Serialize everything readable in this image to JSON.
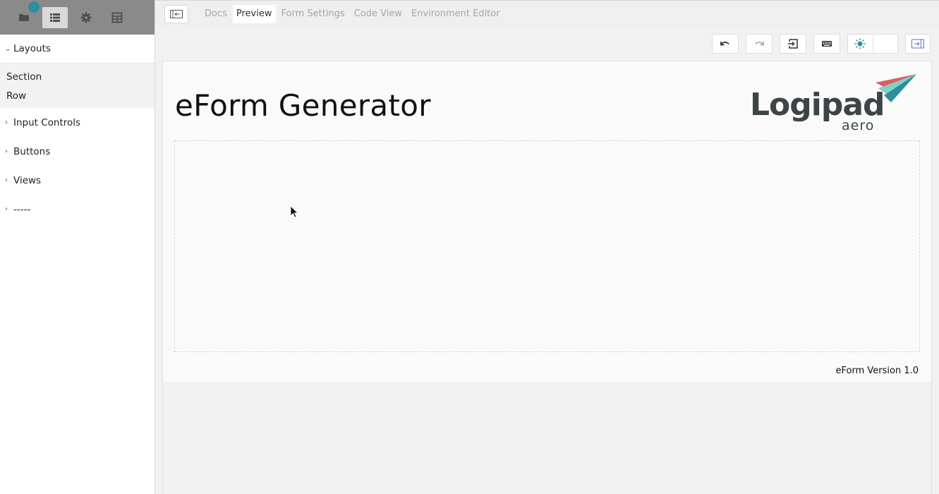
{
  "sidebar": {
    "toolbar": {
      "icons": [
        "folder-icon",
        "list-icon",
        "gear-icon",
        "table-icon"
      ],
      "active_index": 1
    },
    "categories": [
      {
        "label": "Layouts",
        "expanded": true,
        "items": [
          "Section",
          "Row"
        ]
      },
      {
        "label": "Input Controls",
        "expanded": false
      },
      {
        "label": "Buttons",
        "expanded": false
      },
      {
        "label": "Views",
        "expanded": false
      },
      {
        "label": "-----",
        "expanded": false
      }
    ]
  },
  "topbar": {
    "tabs": [
      {
        "label": "Docs",
        "active": false
      },
      {
        "label": "Preview",
        "active": true
      },
      {
        "label": "Form Settings",
        "active": false
      },
      {
        "label": "Code View",
        "active": false
      },
      {
        "label": "Environment Editor",
        "active": false
      }
    ]
  },
  "toolbar": {
    "buttons": [
      "undo-icon",
      "redo-icon",
      "import-icon",
      "keyboard-icon",
      "sun-icon",
      "moon-icon",
      "collapse-right-panel-icon"
    ]
  },
  "form": {
    "title": "eForm Generator",
    "logo": {
      "name": "Logipad",
      "sub": "aero"
    },
    "version": "eForm Version 1.0"
  },
  "colors": {
    "accent": "#2c8fa0",
    "sidebar_header": "#8a8a8a",
    "logo_teal": "#5bbcb4",
    "logo_red": "#e05b5f",
    "toggle_blue": "#5b6fd6"
  }
}
